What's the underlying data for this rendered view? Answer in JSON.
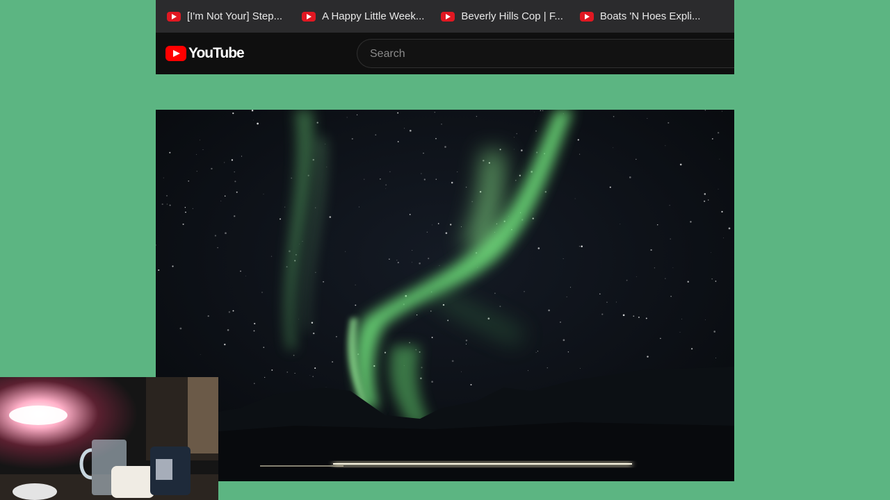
{
  "bookmarks": [
    {
      "label": "[I'm Not Your] Step...",
      "icon": "youtube-icon"
    },
    {
      "label": "A Happy Little Week...",
      "icon": "youtube-icon"
    },
    {
      "label": "Beverly Hills Cop | F...",
      "icon": "youtube-icon"
    },
    {
      "label": "Boats 'N Hoes Expli...",
      "icon": "youtube-icon"
    }
  ],
  "header": {
    "logo_text": "YouTube",
    "search_placeholder": "Search"
  },
  "colors": {
    "background": "#5cb582",
    "youtube_red": "#ff0000",
    "header_bg": "#0f0f0f",
    "bookmarks_bg": "#2b2b2d"
  }
}
